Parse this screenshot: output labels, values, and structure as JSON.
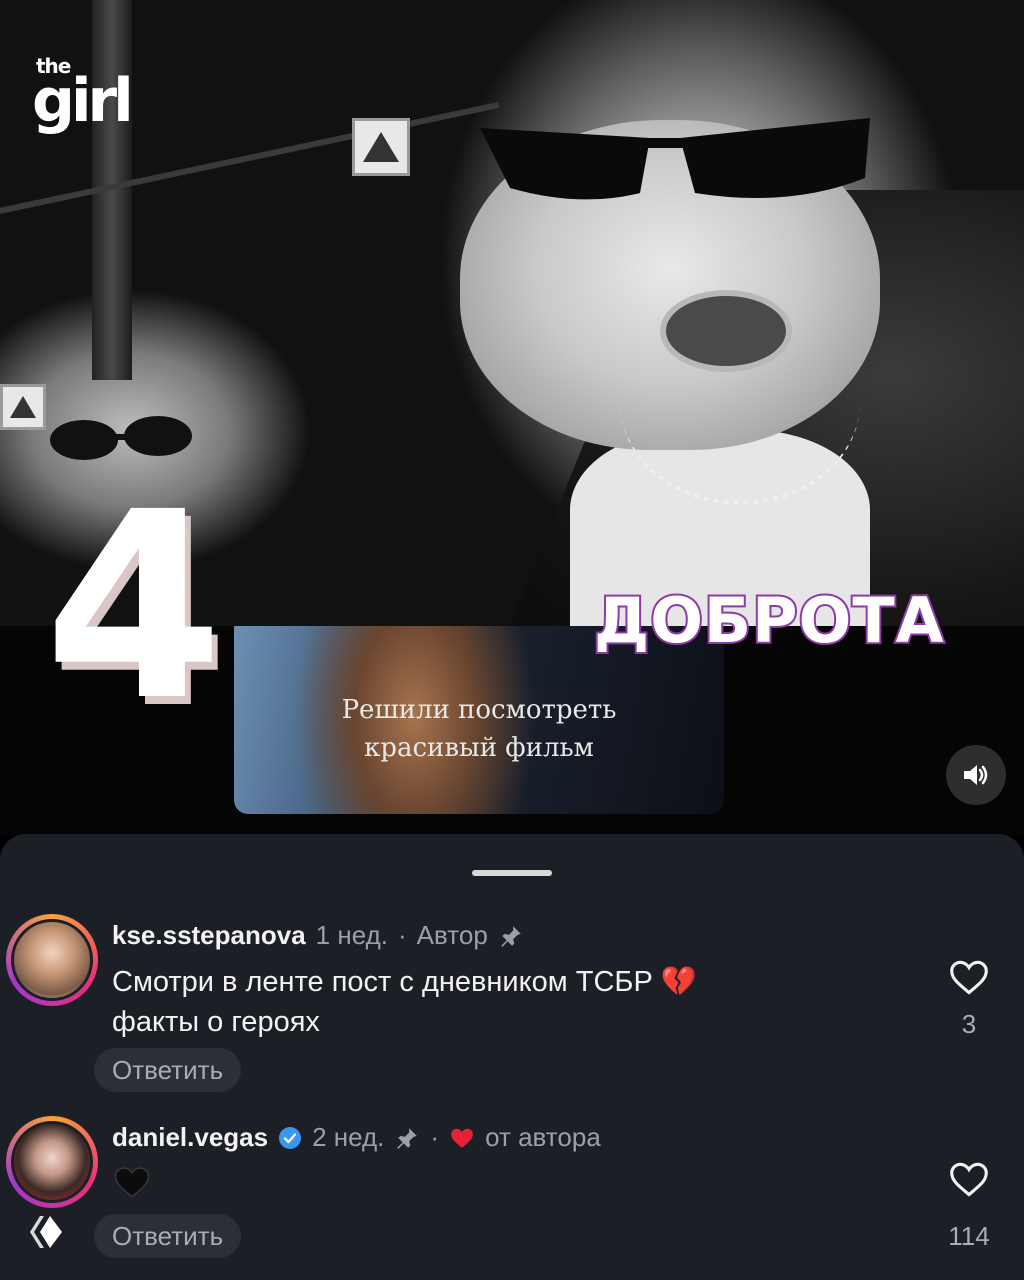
{
  "brand": {
    "logo_small": "the",
    "logo_large": "girl"
  },
  "overlay": {
    "number": "4",
    "word": "ДОБРОТА",
    "word_stroke_color": "#8c3aa8"
  },
  "reel": {
    "caption_line1": "Решили посмотреть",
    "caption_line2": "красивый фильм",
    "sound_icon": "speaker-on-icon"
  },
  "comments": [
    {
      "username": "kse.sstepanova",
      "time": "1 нед.",
      "separator": "·",
      "tag": "Автор",
      "pinned": true,
      "text_line1": "Смотри в ленте пост с дневником ТСБР 💔",
      "text_line2": "факты о героях",
      "reply_label": "Ответить",
      "likes": "3"
    },
    {
      "username": "daniel.vegas",
      "verified": true,
      "time": "2 нед.",
      "separator": "·",
      "liked_by_author_label": "от автора",
      "pinned": true,
      "text": "🖤",
      "reply_label": "Ответить",
      "likes": "114"
    }
  ],
  "colors": {
    "sheet_bg": "#1c1f26",
    "heart_red": "#e8213a",
    "verified_blue": "#3897f0"
  }
}
